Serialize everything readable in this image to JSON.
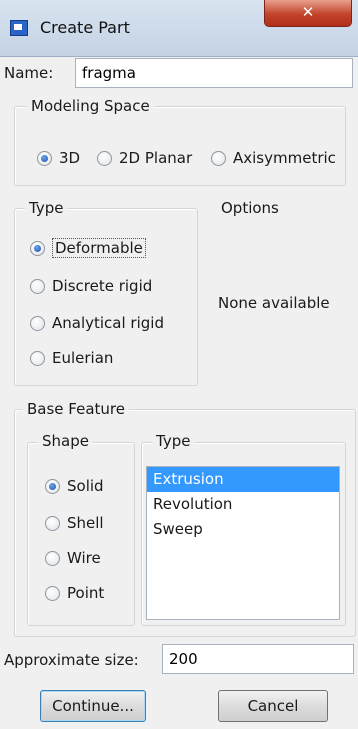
{
  "window": {
    "title": "Create Part",
    "close_glyph": "✕"
  },
  "name": {
    "label": "Name:",
    "value": "fragma"
  },
  "modeling_space": {
    "title": "Modeling Space",
    "options": [
      {
        "label": "3D",
        "selected": true
      },
      {
        "label": "2D Planar",
        "selected": false
      },
      {
        "label": "Axisymmetric",
        "selected": false
      }
    ]
  },
  "type": {
    "title": "Type",
    "options": [
      {
        "label": "Deformable",
        "selected": true
      },
      {
        "label": "Discrete rigid",
        "selected": false
      },
      {
        "label": "Analytical rigid",
        "selected": false
      },
      {
        "label": "Eulerian",
        "selected": false
      }
    ]
  },
  "options": {
    "title": "Options",
    "text": "None available"
  },
  "base_feature": {
    "title": "Base Feature",
    "shape": {
      "title": "Shape",
      "options": [
        {
          "label": "Solid",
          "selected": true
        },
        {
          "label": "Shell",
          "selected": false
        },
        {
          "label": "Wire",
          "selected": false
        },
        {
          "label": "Point",
          "selected": false
        }
      ]
    },
    "type": {
      "title": "Type",
      "items": [
        "Extrusion",
        "Revolution",
        "Sweep"
      ],
      "selected": "Extrusion"
    }
  },
  "approx_size": {
    "label": "Approximate size:",
    "value": "200"
  },
  "buttons": {
    "continue": "Continue...",
    "cancel": "Cancel"
  },
  "colors": {
    "selection": "#3399ff",
    "close_button": "#c0432a"
  }
}
